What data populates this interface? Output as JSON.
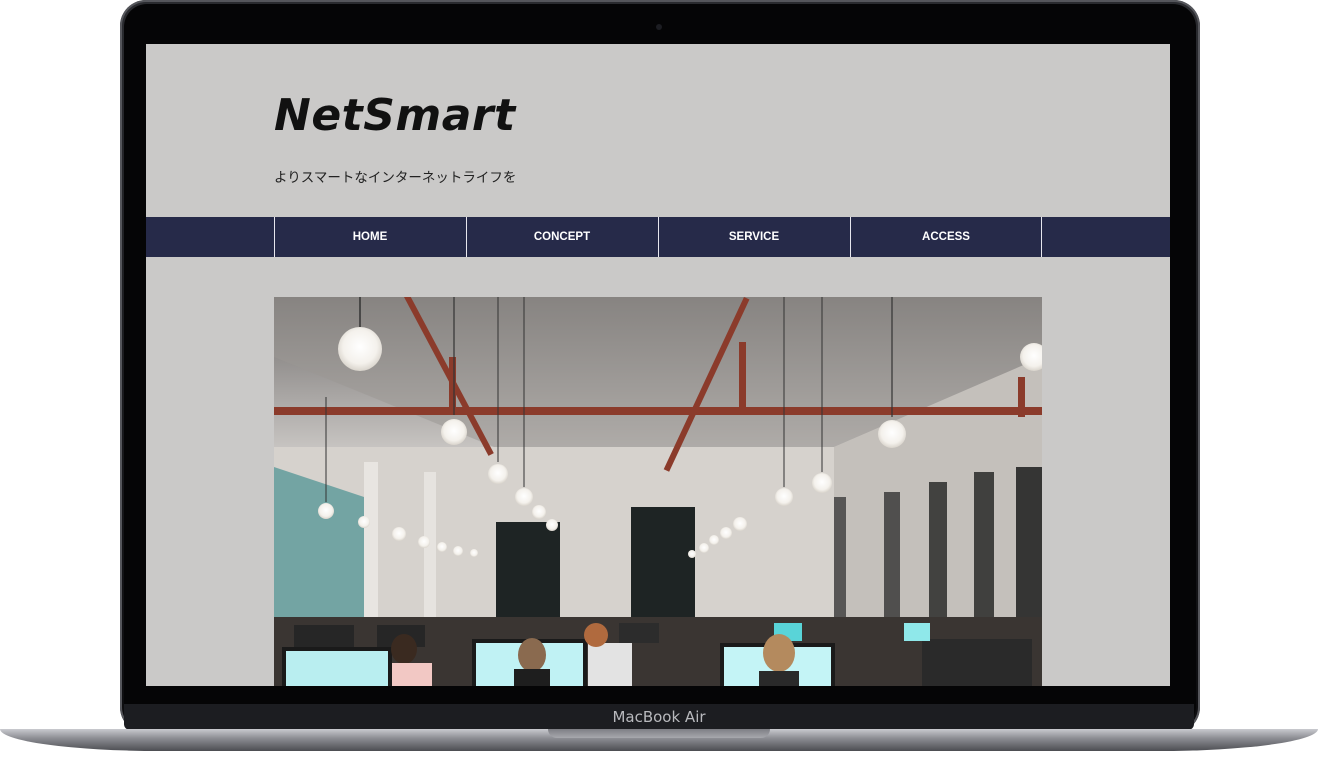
{
  "device": {
    "label": "MacBook Air"
  },
  "site": {
    "logo": "NetSmart",
    "tagline": "よりスマートなインターネットライフを"
  },
  "nav": {
    "items": [
      {
        "label": "HOME"
      },
      {
        "label": "CONCEPT"
      },
      {
        "label": "SERVICE"
      },
      {
        "label": "ACCESS"
      }
    ]
  },
  "colors": {
    "page_background": "#cac9c8",
    "nav_background": "#262a49",
    "nav_text": "#ffffff",
    "logo_text": "#111111"
  },
  "hero": {
    "image_subject": "open office with hanging light bulbs and people at computers"
  }
}
